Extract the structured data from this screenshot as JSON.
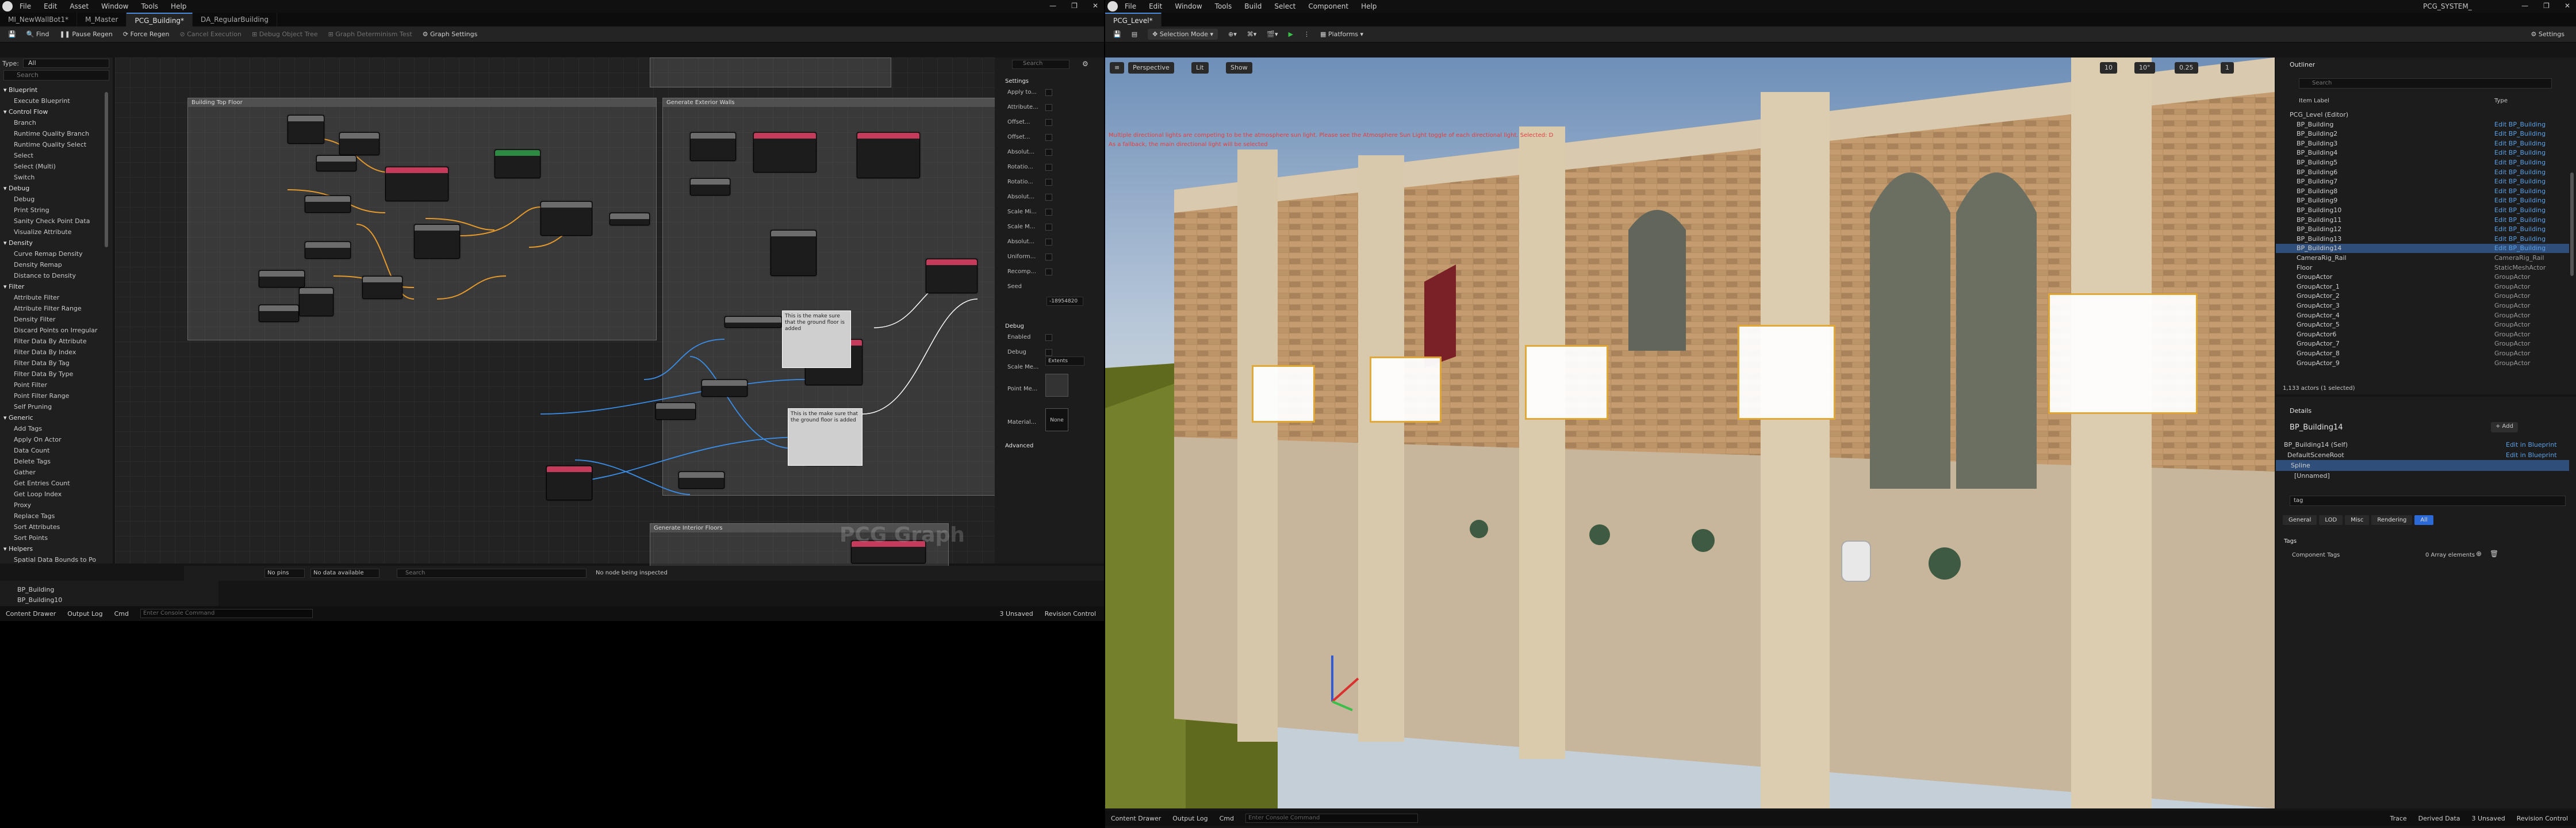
{
  "left": {
    "title_menu": [
      "File",
      "Edit",
      "Asset",
      "Window",
      "Tools",
      "Help"
    ],
    "tabs": [
      {
        "label": "MI_NewWallBot1*",
        "active": false
      },
      {
        "label": "M_Master",
        "active": false
      },
      {
        "label": "PCG_Building*",
        "active": true
      },
      {
        "label": "DA_RegularBuilding",
        "active": false
      }
    ],
    "toolbar": {
      "save": "",
      "find": "Find",
      "pause_regen": "Pause Regen",
      "force_regen": "Force Regen",
      "cancel_exec": "Cancel Execution",
      "debug_object_tree": "Debug Object Tree",
      "graph_determinism": "Graph Determinism Test",
      "graph_settings": "Graph Settings"
    },
    "palette": {
      "type_label": "Type:",
      "type_value": "All",
      "search_placeholder": "Search",
      "items": [
        {
          "t": "Blueprint",
          "cat": true
        },
        {
          "t": "Execute Blueprint",
          "cat": false
        },
        {
          "t": "Control Flow",
          "cat": true
        },
        {
          "t": "Branch",
          "cat": false
        },
        {
          "t": "Runtime Quality Branch",
          "cat": false
        },
        {
          "t": "Runtime Quality Select",
          "cat": false
        },
        {
          "t": "Select",
          "cat": false
        },
        {
          "t": "Select (Multi)",
          "cat": false
        },
        {
          "t": "Switch",
          "cat": false
        },
        {
          "t": "Debug",
          "cat": true
        },
        {
          "t": "Debug",
          "cat": false
        },
        {
          "t": "Print String",
          "cat": false
        },
        {
          "t": "Sanity Check Point Data",
          "cat": false
        },
        {
          "t": "Visualize Attribute",
          "cat": false
        },
        {
          "t": "Density",
          "cat": true
        },
        {
          "t": "Curve Remap Density",
          "cat": false
        },
        {
          "t": "Density Remap",
          "cat": false
        },
        {
          "t": "Distance to Density",
          "cat": false
        },
        {
          "t": "Filter",
          "cat": true
        },
        {
          "t": "Attribute Filter",
          "cat": false
        },
        {
          "t": "Attribute Filter Range",
          "cat": false
        },
        {
          "t": "Density Filter",
          "cat": false
        },
        {
          "t": "Discard Points on Irregular",
          "cat": false
        },
        {
          "t": "Filter Data By Attribute",
          "cat": false
        },
        {
          "t": "Filter Data By Index",
          "cat": false
        },
        {
          "t": "Filter Data By Tag",
          "cat": false
        },
        {
          "t": "Filter Data By Type",
          "cat": false
        },
        {
          "t": "Point Filter",
          "cat": false
        },
        {
          "t": "Point Filter Range",
          "cat": false
        },
        {
          "t": "Self Pruning",
          "cat": false
        },
        {
          "t": "Generic",
          "cat": true
        },
        {
          "t": "Add Tags",
          "cat": false
        },
        {
          "t": "Apply On Actor",
          "cat": false
        },
        {
          "t": "Data Count",
          "cat": false
        },
        {
          "t": "Delete Tags",
          "cat": false
        },
        {
          "t": "Gather",
          "cat": false
        },
        {
          "t": "Get Entries Count",
          "cat": false
        },
        {
          "t": "Get Loop Index",
          "cat": false
        },
        {
          "t": "Proxy",
          "cat": false
        },
        {
          "t": "Replace Tags",
          "cat": false
        },
        {
          "t": "Sort Attributes",
          "cat": false
        },
        {
          "t": "Sort Points",
          "cat": false
        },
        {
          "t": "Helpers",
          "cat": true
        },
        {
          "t": "Spatial Data Bounds to Po",
          "cat": false
        }
      ]
    },
    "graph": {
      "comment_1": "Building Top Floor",
      "comment_2": "Generate Exterior Walls",
      "comment_3": "Generate Interior Floors",
      "watermark": "PCG Graph",
      "note_1": "This is the make sure that the ground floor is added",
      "note_2": "This is the make sure that the ground floor is added"
    },
    "details": {
      "search_placeholder": "Search",
      "section_settings": "Settings",
      "section_debug": "Debug",
      "section_advanced": "Advanced",
      "rows": [
        {
          "label": "Apply to..."
        },
        {
          "label": "Attribute..."
        },
        {
          "label": "Offset..."
        },
        {
          "label": "Offset..."
        },
        {
          "label": "Absolut..."
        },
        {
          "label": "Rotatio..."
        },
        {
          "label": "Rotatio..."
        },
        {
          "label": "Absolut..."
        },
        {
          "label": "Scale Mi..."
        },
        {
          "label": "Scale M..."
        },
        {
          "label": "Absolut..."
        },
        {
          "label": "Uniform..."
        },
        {
          "label": "Recomp..."
        },
        {
          "label": "Seed"
        }
      ],
      "seed_value": "-18954820",
      "debug_rows": [
        {
          "label": "Enabled"
        },
        {
          "label": "Debug"
        },
        {
          "label": "Scale Me..."
        },
        {
          "label": "Point Me..."
        },
        {
          "label": "Material..."
        }
      ],
      "scale_method": "Extents",
      "material_value": "None"
    },
    "attr_bar": {
      "no_pins": "No pins",
      "no_data": "No data available",
      "search_placeholder": "Search",
      "no_node_msg": "No node being inspected"
    },
    "outliner_rows": [
      "BP_Building",
      "BP_Building10"
    ],
    "status": {
      "content_drawer": "Content Drawer",
      "output_log": "Output Log",
      "cmd": "Cmd",
      "console_placeholder": "Enter Console Command",
      "unsaved": "3 Unsaved",
      "revision": "Revision Control"
    }
  },
  "right": {
    "title_menu": [
      "File",
      "Edit",
      "Window",
      "Tools",
      "Build",
      "Select",
      "Component",
      "Help"
    ],
    "project_name": "PCG_SYSTEM_",
    "level_tab": "PCG_Level*",
    "toolbar": {
      "selection_mode": "Selection Mode",
      "platforms": "Platforms",
      "settings": "Settings"
    },
    "viewport": {
      "perspective": "Perspective",
      "lit": "Lit",
      "show": "Show",
      "warning_1": "Multiple directional lights are competing to be the atmosphere sun light. Please see the Atmosphere Sun Light toggle of each directional light. Selected: D",
      "warning_2": "As a fallback, the main directional light will be selected",
      "grid_size": "10",
      "rot_snap": "10°",
      "scale_snap": "0.25",
      "cam_speed": "1"
    },
    "outliner": {
      "title": "Outliner",
      "search_placeholder": "Search",
      "col_label": "Item Label",
      "col_type": "Type",
      "rows": [
        {
          "name": "PCG_Level (Editor)",
          "type": "",
          "g": true
        },
        {
          "name": "BP_Building",
          "type": "Edit BP_Building",
          "g": false
        },
        {
          "name": "BP_Building2",
          "type": "Edit BP_Building",
          "g": false
        },
        {
          "name": "BP_Building3",
          "type": "Edit BP_Building",
          "g": false
        },
        {
          "name": "BP_Building4",
          "type": "Edit BP_Building",
          "g": false
        },
        {
          "name": "BP_Building5",
          "type": "Edit BP_Building",
          "g": false
        },
        {
          "name": "BP_Building6",
          "type": "Edit BP_Building",
          "g": false
        },
        {
          "name": "BP_Building7",
          "type": "Edit BP_Building",
          "g": false
        },
        {
          "name": "BP_Building8",
          "type": "Edit BP_Building",
          "g": false
        },
        {
          "name": "BP_Building9",
          "type": "Edit BP_Building",
          "g": false
        },
        {
          "name": "BP_Building10",
          "type": "Edit BP_Building",
          "g": false
        },
        {
          "name": "BP_Building11",
          "type": "Edit BP_Building",
          "g": false
        },
        {
          "name": "BP_Building12",
          "type": "Edit BP_Building",
          "g": false
        },
        {
          "name": "BP_Building13",
          "type": "Edit BP_Building",
          "g": false
        },
        {
          "name": "BP_Building14",
          "type": "Edit BP_Building",
          "g": false,
          "selected": true
        },
        {
          "name": "CameraRig_Rail",
          "type": "CameraRig_Rail",
          "g": true
        },
        {
          "name": "Floor",
          "type": "StaticMeshActor",
          "g": true
        },
        {
          "name": "GroupActor",
          "type": "GroupActor",
          "g": true
        },
        {
          "name": "GroupActor_1",
          "type": "GroupActor",
          "g": true
        },
        {
          "name": "GroupActor_2",
          "type": "GroupActor",
          "g": true
        },
        {
          "name": "GroupActor_3",
          "type": "GroupActor",
          "g": true
        },
        {
          "name": "GroupActor_4",
          "type": "GroupActor",
          "g": true
        },
        {
          "name": "GroupActor_5",
          "type": "GroupActor",
          "g": true
        },
        {
          "name": "GroupActor6",
          "type": "GroupActor",
          "g": true
        },
        {
          "name": "GroupActor_7",
          "type": "GroupActor",
          "g": true
        },
        {
          "name": "GroupActor_8",
          "type": "GroupActor",
          "g": true
        },
        {
          "name": "GroupActor_9",
          "type": "GroupActor",
          "g": true
        }
      ],
      "count": "1,133 actors (1 selected)"
    },
    "details": {
      "title": "Details",
      "actor_name": "BP_Building14",
      "add": "+ Add",
      "components": [
        {
          "name": "BP_Building14 (Self)",
          "link": "Edit in Blueprint"
        },
        {
          "name": "DefaultSceneRoot",
          "link": "Edit in Blueprint"
        },
        {
          "name": "Spline",
          "link": ""
        },
        {
          "name": "[Unnamed]",
          "link": ""
        }
      ],
      "search_value": "tag",
      "filters": [
        "General",
        "LOD",
        "Misc",
        "Rendering",
        "All"
      ],
      "section_tags": "Tags",
      "component_tags_label": "Component Tags",
      "component_tags_value": "0 Array elements"
    },
    "status": {
      "content_drawer": "Content Drawer",
      "output_log": "Output Log",
      "cmd": "Cmd",
      "console_placeholder": "Enter Console Command",
      "trace": "Trace",
      "derived_data": "Derived Data",
      "unsaved": "3 Unsaved",
      "revision": "Revision Control"
    }
  }
}
